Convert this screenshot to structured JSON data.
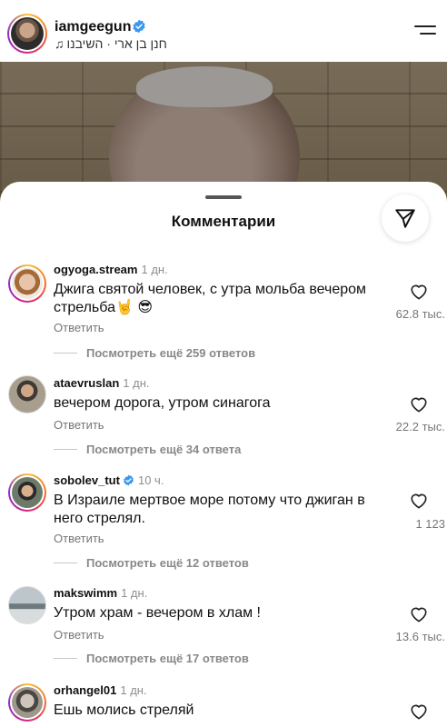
{
  "header": {
    "username": "iamgeegun",
    "audio": "חנן בן ארי · השיבנו"
  },
  "sheet": {
    "title": "Комментарии"
  },
  "comments": [
    {
      "username": "ogyoga.stream",
      "time": "1 дн.",
      "text": "Джига святой человек, с утра мольба вечером стрельба🤘 😎",
      "reply": "Ответить",
      "likes": "62.8 тыс.",
      "more": "Посмотреть ещё 259 ответов",
      "verified": false,
      "story_ring": true
    },
    {
      "username": "ataevruslan",
      "time": "1 дн.",
      "text": "вечером дорога, утром синагога",
      "reply": "Ответить",
      "likes": "22.2 тыс.",
      "more": "Посмотреть ещё 34 ответа",
      "verified": false,
      "story_ring": false
    },
    {
      "username": "sobolev_tut",
      "time": "10 ч.",
      "text": "В Израиле мертвое море потому что джиган в него стрелял.",
      "reply": "Ответить",
      "likes": "1 123",
      "more": "Посмотреть ещё 12 ответов",
      "verified": true,
      "story_ring": true
    },
    {
      "username": "makswimm",
      "time": "1 дн.",
      "text": "Утром храм - вечером в хлам !",
      "reply": "Ответить",
      "likes": "13.6 тыс.",
      "more": "Посмотреть ещё 17 ответов",
      "verified": false,
      "story_ring": false
    },
    {
      "username": "orhangel01",
      "time": "1 дн.",
      "text": "Ешь молись стреляй",
      "reply": "",
      "likes": "",
      "more": "",
      "verified": false,
      "story_ring": true
    }
  ],
  "colors": {
    "verified": "#3897f0",
    "muted": "#8e8e8e"
  }
}
